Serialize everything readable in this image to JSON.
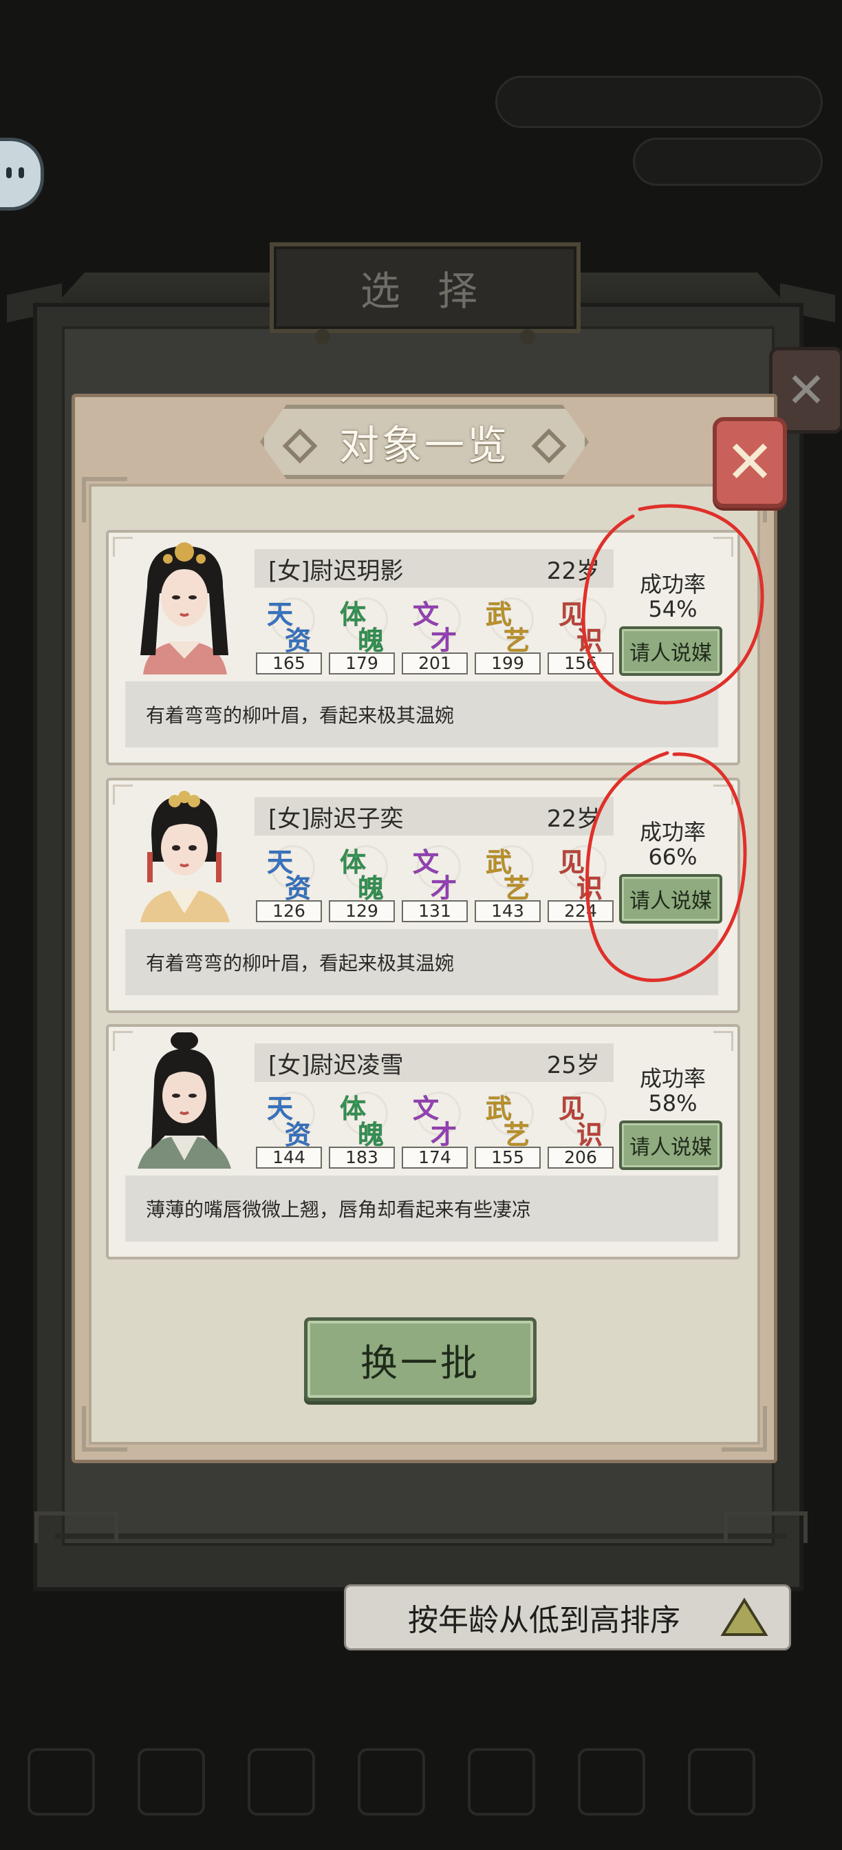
{
  "background": {
    "panel_title": "选 择"
  },
  "dialog": {
    "title": "对象一览",
    "close_glyph": "✕"
  },
  "stat_labels": [
    {
      "a": "天",
      "b": "资",
      "color": "#3d7fd6"
    },
    {
      "a": "体",
      "b": "魄",
      "color": "#3aa25c"
    },
    {
      "a": "文",
      "b": "才",
      "color": "#a347c7"
    },
    {
      "a": "武",
      "b": "艺",
      "color": "#d0a12c"
    },
    {
      "a": "见",
      "b": "识",
      "color": "#cf4a3f"
    }
  ],
  "candidates": [
    {
      "name": "[女]尉迟玥影",
      "age": "22岁",
      "stats": [
        "165",
        "179",
        "201",
        "199",
        "156"
      ],
      "rate_label": "成功率",
      "rate": "54%",
      "button": "请人说媒",
      "description": "有着弯弯的柳叶眉，看起来极其温婉"
    },
    {
      "name": "[女]尉迟子奕",
      "age": "22岁",
      "stats": [
        "126",
        "129",
        "131",
        "143",
        "224"
      ],
      "rate_label": "成功率",
      "rate": "66%",
      "button": "请人说媒",
      "description": "有着弯弯的柳叶眉，看起来极其温婉"
    },
    {
      "name": "[女]尉迟凌雪",
      "age": "25岁",
      "stats": [
        "144",
        "183",
        "174",
        "155",
        "206"
      ],
      "rate_label": "成功率",
      "rate": "58%",
      "button": "请人说媒",
      "description": "薄薄的嘴唇微微上翘，唇角却看起来有些凄凉"
    }
  ],
  "refresh_button": "换一批",
  "sort": {
    "label": "按年龄从低到高排序"
  },
  "colors": {
    "accent_green": "#8fab7f",
    "close_red": "#c9615a",
    "annotation_red": "#e0302a"
  }
}
